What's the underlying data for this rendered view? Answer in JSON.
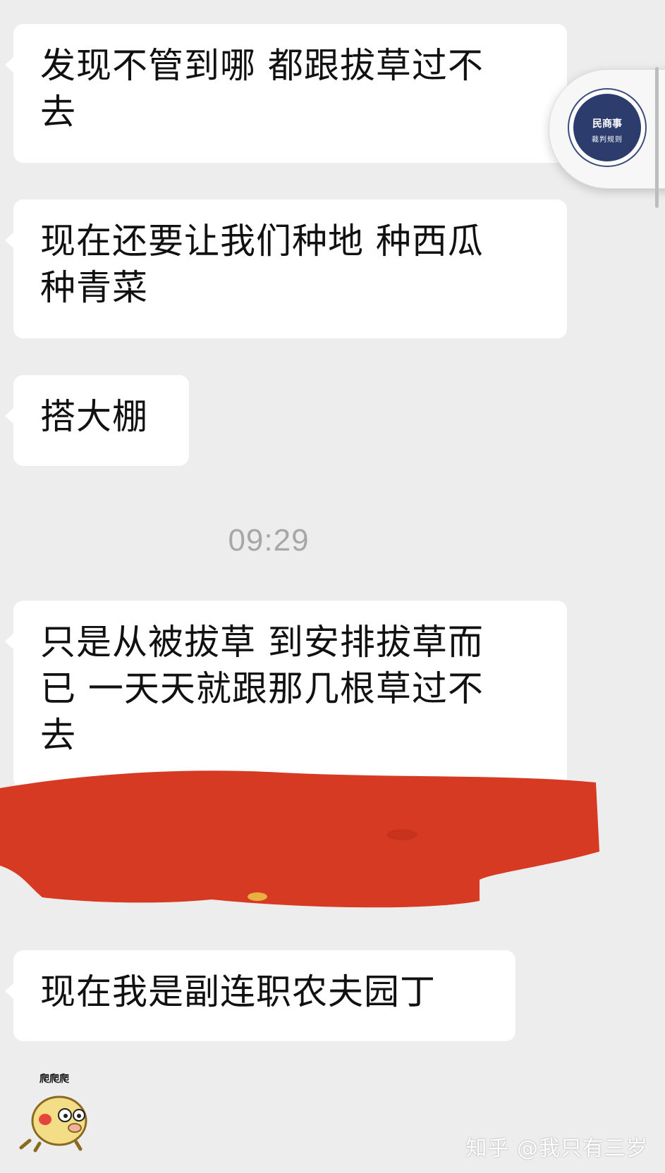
{
  "messages": [
    {
      "text": "发现不管到哪 都跟拔草过不\n去"
    },
    {
      "text": "现在还要让我们种地 种西瓜\n种青菜"
    },
    {
      "text": "搭大棚"
    },
    {
      "text": "只是从被拔草 到安排拔草而\n已 一天天就跟那几根草过不\n去"
    },
    {
      "text": "现在我是副连职农夫园丁"
    }
  ],
  "timestamp": "09:29",
  "float_widget": {
    "logo_line1": "民商事",
    "logo_line2": "裁判规则"
  },
  "sticker": {
    "caption": "爬爬爬",
    "icon": "pig-crawling-sticker-icon"
  },
  "watermark": "知乎 @我只有三岁",
  "colors": {
    "background": "#ededed",
    "bubble": "#ffffff",
    "redaction": "#d63a22",
    "logo": "#2c3c6c"
  }
}
